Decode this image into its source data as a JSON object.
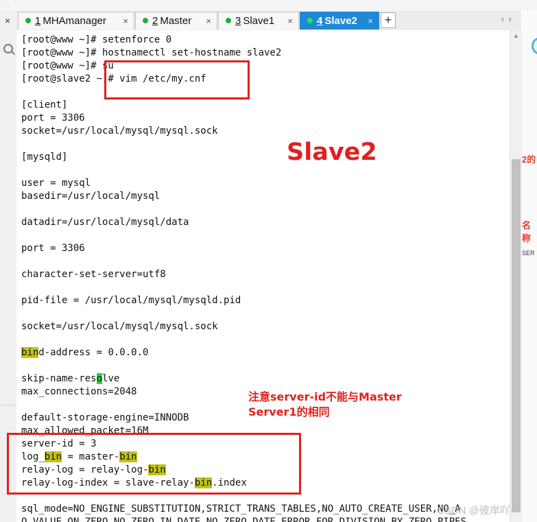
{
  "tabs": [
    {
      "num": "1",
      "label": "MHAmanager",
      "active": false
    },
    {
      "num": "2",
      "label": "Master",
      "active": false
    },
    {
      "num": "3",
      "label": "Slave1",
      "active": false
    },
    {
      "num": "4",
      "label": "Slave2",
      "active": true
    }
  ],
  "tab_close_glyph": "×",
  "add_tab_glyph": "+",
  "nav_glyphs": "‹›",
  "left_close_glyph": "×",
  "top_hint": "…",
  "terminal": {
    "l1": "[root@www ~]# setenforce 0",
    "l2": "[root@www ~]# hostnamectl set-hostname slave2",
    "l3": "[root@www ~]# su",
    "l4": "[root@slave2 ~]# vim /etc/my.cnf",
    "l5": "",
    "l6": "[client]",
    "l7": "port = 3306",
    "l8": "socket=/usr/local/mysql/mysql.sock",
    "l9": "",
    "l10": "[mysqld]",
    "l11": "",
    "l12": "user = mysql",
    "l13": "basedir=/usr/local/mysql",
    "l14": "",
    "l15": "datadir=/usr/local/mysql/data",
    "l16": "",
    "l17": "port = 3306",
    "l18": "",
    "l19": "character-set-server=utf8",
    "l20": "",
    "l21": "pid-file = /usr/local/mysql/mysqld.pid",
    "l22": "",
    "l23": "socket=/usr/local/mysql/mysql.sock",
    "l24": "",
    "l25a": "bin",
    "l25b": "d-address = 0.0.0.0",
    "l26": "",
    "l27a": "skip-name-res",
    "l27b": "o",
    "l27c": "lve",
    "l28": "max_connections=2048",
    "l29": "",
    "l30": "default-storage-engine=INNODB",
    "l31": "max_allowed_packet=16M",
    "l32": "server-id = 3",
    "l33a": "log_",
    "l33b": "bin",
    "l33c": " = master-",
    "l33d": "bin",
    "l34a": "relay-log = relay-log-",
    "l34b": "bin",
    "l35a": "relay-log-index = slave-relay-",
    "l35b": "bin",
    "l35c": ".index",
    "l36": "",
    "l37": "sql_mode=NO_ENGINE_SUBSTITUTION,STRICT_TRANS_TABLES,NO_AUTO_CREATE_USER,NO_A",
    "l38": "O_VALUE_ON_ZERO,NO_ZERO_IN_DATE,NO_ZERO_DATE,ERROR_FOR_DIVISION_BY_ZERO,PIPES"
  },
  "annotations": {
    "slave2_label": "Slave2",
    "note_line1": "注意server-id不能与Master",
    "note_line2": "Server1的相同"
  },
  "right_strip": {
    "frag1": "2的",
    "frag2": "名称",
    "frag3": "SER"
  },
  "watermark": "CSDN @彼岸吖",
  "colors": {
    "annotation_red": "#e0201e",
    "highlight": "#c2c21a",
    "cursor": "#27d92a",
    "active_tab": "#1e8ad6"
  }
}
